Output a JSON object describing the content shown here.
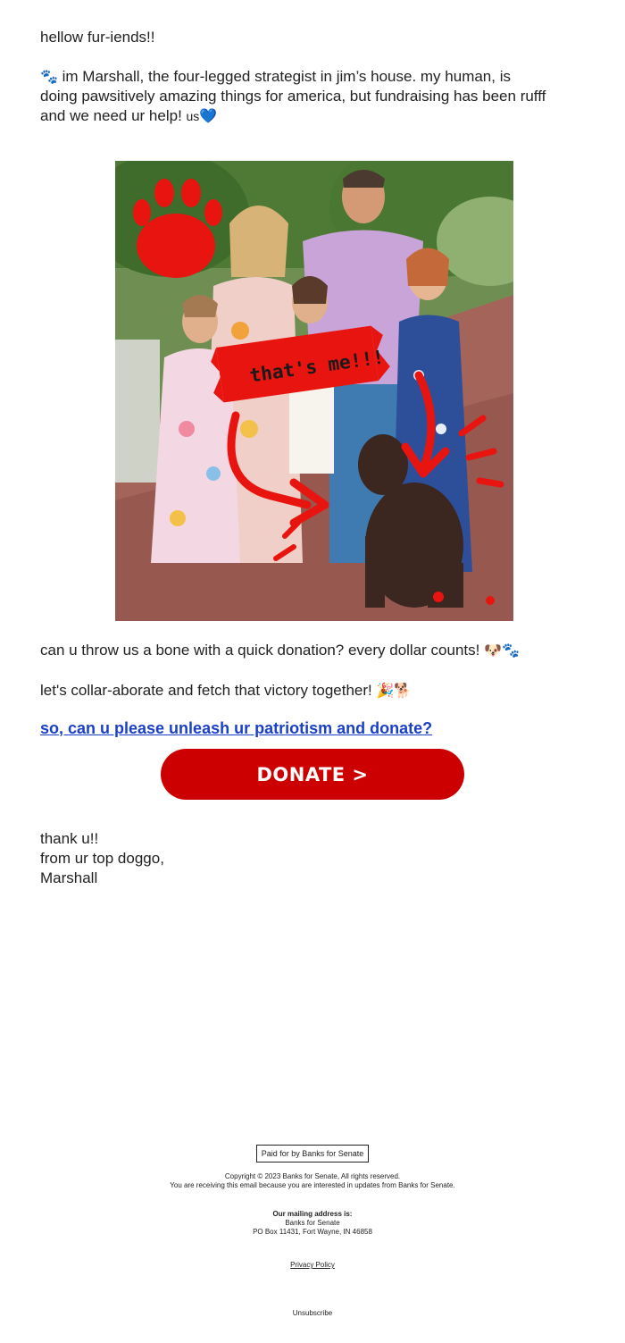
{
  "email": {
    "greeting": "hellow fur-iends!!",
    "intro_paw": "🐾",
    "intro_line1": " im Marshall, the four-legged strategist in jim’s house. my human, is",
    "intro_line2": "doing pawsitively amazing things for america, but fundraising has been rufff",
    "intro_line3": "and we need ur help! ",
    "intro_flag": "us",
    "intro_heart": "💙",
    "photo": {
      "overlay_text": "that's me!!!"
    },
    "bone_text": "can u throw us a bone with a quick donation? every dollar counts! ",
    "bone_emoji": "🐶🐾",
    "collar_text": "let's collar-aborate and fetch that victory together! ",
    "collar_emoji": "🎉🐕",
    "cta_link": "so, can u please unleash ur patriotism and donate?",
    "donate_button": "DONATE >",
    "signoff_line1": "thank u!!",
    "signoff_line2": "from ur top doggo,",
    "signoff_line3": "Marshall"
  },
  "footer": {
    "paid_for": "Paid for by Banks for Senate",
    "copyright": "Copyright © 2023 Banks for Senate, All rights reserved.",
    "receiving": "You are receiving this email because you are interested in updates from Banks for Senate.",
    "mailing_heading": "Our mailing address is:",
    "mailing_name": "Banks for Senate",
    "mailing_address": "PO Box 11431, Fort Wayne, IN 46858",
    "privacy": "Privacy Policy",
    "unsubscribe": "Unsubscribe"
  },
  "colors": {
    "accent_red": "#cc0000",
    "link_blue": "#1a3fc8",
    "heart_blue": "#2fa7e0"
  }
}
